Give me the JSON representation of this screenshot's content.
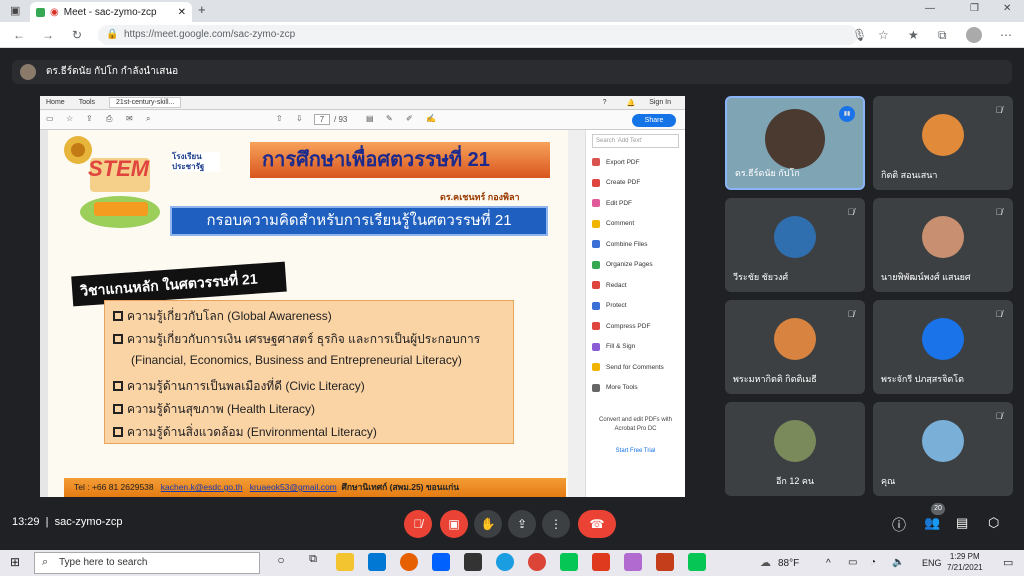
{
  "browser": {
    "tab_title": "Meet - sac-zymo-zcp",
    "url": "https://meet.google.com/sac-zymo-zcp",
    "new_tab": "+"
  },
  "presenter": {
    "label": "ดร.ธีร์ดนัย กัปโก กำลังนำเสนอ"
  },
  "pdf": {
    "menu": [
      "Home",
      "Tools"
    ],
    "file_tab": "21st-century-skill...",
    "signin": "Sign In",
    "page_current": "7",
    "page_total": "/ 93",
    "share": "Share",
    "search_placeholder": "Search 'Add Text'",
    "tools": [
      {
        "label": "Export PDF",
        "color": "#d9534f"
      },
      {
        "label": "Create PDF",
        "color": "#e0443e"
      },
      {
        "label": "Edit PDF",
        "color": "#e05a9a"
      },
      {
        "label": "Comment",
        "color": "#f0b400"
      },
      {
        "label": "Combine Files",
        "color": "#3a6fd8"
      },
      {
        "label": "Organize Pages",
        "color": "#36a852"
      },
      {
        "label": "Redact",
        "color": "#e0443e"
      },
      {
        "label": "Protect",
        "color": "#3a6fd8"
      },
      {
        "label": "Compress PDF",
        "color": "#e0443e"
      },
      {
        "label": "Fill & Sign",
        "color": "#8a5cd6"
      },
      {
        "label": "Send for Comments",
        "color": "#f0b400"
      },
      {
        "label": "More Tools",
        "color": "#666666"
      }
    ],
    "promo": "Convert and edit PDFs with Acrobat Pro DC",
    "trial": "Start Free Trial"
  },
  "slide": {
    "logo_text": "STEM",
    "school_label": "โรงเรียน ประชารัฐ",
    "title": "การศึกษาเพื่อศตวรรษที่ 21",
    "author": "ดร.ฅเชนทร์  กองพิลา",
    "subtitle": "กรอบความคิดสำหรับการเรียนรู้ในศตวรรษที่ 21",
    "heading": "วิชาแกนหลัก ในศตวรรษที่ 21",
    "items": [
      "ความรู้เกี่ยวกับโลก (Global Awareness)",
      "ความรู้เกี่ยวกับการเงิน เศรษฐศาสตร์ ธุรกิจ และการเป็นผู้ประกอบการ",
      "(Financial, Economics, Business and Entrepreneurial Literacy)",
      "ความรู้ด้านการเป็นพลเมืองที่ดี (Civic Literacy)",
      "ความรู้ด้านสุขภาพ (Health Literacy)",
      "ความรู้ด้านสิ่งแวดล้อม (Environmental Literacy)"
    ],
    "footer_tel": "Tel : +66 81 2629538",
    "footer_email1": "kachen.k@esdc.go.th",
    "footer_email2": "kruaeok53@gmail.com",
    "footer_org": "ศึกษานิเทศก์ (สพม.25) ขอนแก่น"
  },
  "participants": [
    {
      "name": "ดร.ธีร์ดนัย กัปโก",
      "color": "#7fa4b4",
      "face": "#4a3a30"
    },
    {
      "name": "กิตติ สอนเสนา",
      "color": "#3c4043",
      "face": "#e08a3a"
    },
    {
      "name": "วีระชัย ชัยวงศ์",
      "color": "#3c4043",
      "face": "#2f6fb0"
    },
    {
      "name": "นายพิพัฒน์พงศ์ แสนยศ",
      "color": "#3c4043",
      "face": "#c89070"
    },
    {
      "name": "พระมหากิตติ กิตติเมธี",
      "color": "#3c4043",
      "face": "#d88440"
    },
    {
      "name": "พระจักรี ปภสฺสรจิตโต",
      "color": "#3c4043",
      "face": "#1a73e8"
    },
    {
      "name": "อีก 12 คน",
      "color": "#3c4043",
      "face": "#7a8a5a"
    },
    {
      "name": "คุณ",
      "color": "#3c4043",
      "face": "#7ab0d8"
    }
  ],
  "meeting": {
    "time": "13:29",
    "code": "sac-zymo-zcp",
    "people_count": "20"
  },
  "taskbar": {
    "search": "Type here to search",
    "temp": "88°F",
    "lang": "ENG",
    "time": "1:29 PM",
    "date": "7/21/2021"
  }
}
